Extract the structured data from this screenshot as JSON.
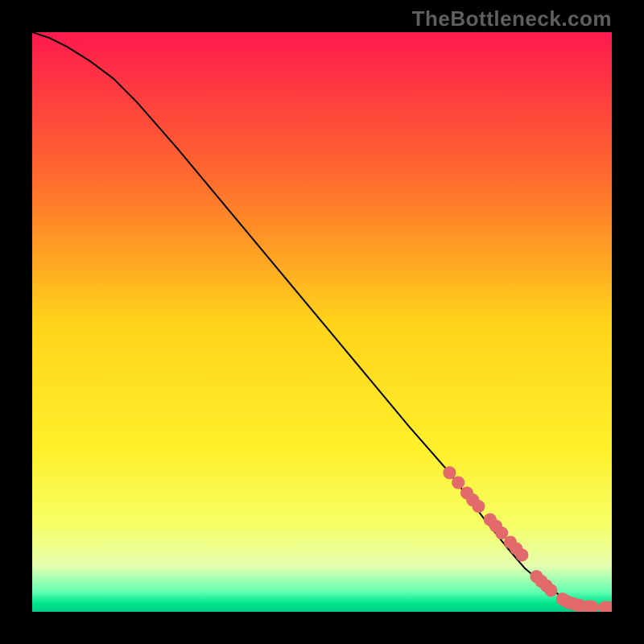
{
  "watermark": "TheBottleneck.com",
  "chart_data": {
    "type": "line",
    "title": "",
    "xlabel": "",
    "ylabel": "",
    "xlim": [
      0,
      100
    ],
    "ylim": [
      0,
      100
    ],
    "grid": false,
    "legend": false,
    "background_gradient_stops": [
      {
        "offset": 0.0,
        "color": "#ff1a4d"
      },
      {
        "offset": 0.25,
        "color": "#ff6a2e"
      },
      {
        "offset": 0.5,
        "color": "#ffd31a"
      },
      {
        "offset": 0.72,
        "color": "#fff02a"
      },
      {
        "offset": 0.85,
        "color": "#f6ff66"
      },
      {
        "offset": 0.92,
        "color": "#e6ffb0"
      },
      {
        "offset": 0.965,
        "color": "#66ffb3"
      },
      {
        "offset": 0.985,
        "color": "#00e68c"
      },
      {
        "offset": 1.0,
        "color": "#00cc88"
      }
    ],
    "series": [
      {
        "name": "curve",
        "type": "line",
        "color": "#000000",
        "stroke_width": 2,
        "x": [
          0,
          3,
          6,
          10,
          14,
          18,
          25,
          35,
          45,
          55,
          65,
          72,
          78,
          82,
          85,
          88,
          90,
          92,
          94,
          96,
          98,
          100
        ],
        "y": [
          100,
          99,
          97.5,
          95,
          92,
          88,
          80,
          68,
          56,
          44,
          32,
          24,
          16,
          11,
          7.5,
          5,
          3.5,
          2.3,
          1.5,
          1.0,
          0.8,
          0.7
        ]
      },
      {
        "name": "highlight-points",
        "type": "scatter",
        "color": "#e26a6a",
        "radius": 8,
        "x": [
          72,
          73.5,
          75,
          76,
          77,
          79,
          80,
          81,
          82.5,
          83.5,
          84.5,
          87,
          87.8,
          88.7,
          89.5,
          91.5,
          92,
          92.6,
          93.3,
          93.9,
          94.5,
          96,
          96.6,
          98.8,
          99.5
        ],
        "y": [
          24.0,
          22.3,
          20.5,
          19.3,
          18.2,
          15.9,
          14.8,
          13.6,
          12.0,
          10.9,
          9.8,
          6.1,
          5.3,
          4.5,
          3.7,
          2.2,
          1.9,
          1.6,
          1.4,
          1.2,
          1.1,
          0.9,
          0.85,
          0.75,
          0.72
        ]
      }
    ]
  }
}
